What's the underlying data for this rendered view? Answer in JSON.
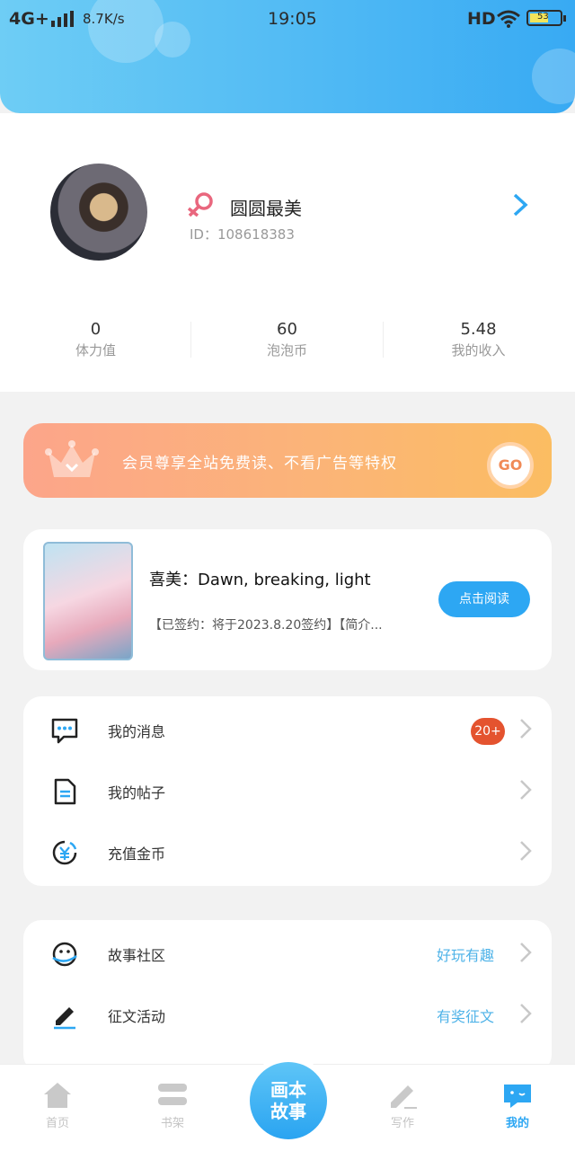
{
  "status_bar": {
    "network": "4G+",
    "speed": "8.7K/s",
    "time": "19:05",
    "hd": "HD",
    "battery": "53"
  },
  "profile": {
    "nickname": "圆圆最美",
    "user_id": "ID：108618383"
  },
  "stats": [
    {
      "value": "0",
      "label": "体力值"
    },
    {
      "value": "60",
      "label": "泡泡币"
    },
    {
      "value": "5.48",
      "label": "我的收入"
    }
  ],
  "vip_banner": {
    "text": "会员尊享全站免费读、不看广告等特权",
    "go_label": "GO"
  },
  "book": {
    "title": "喜美：Dawn, breaking, light",
    "description": "【已签约：将于2023.8.20签约】【简介...",
    "read_button": "点击阅读"
  },
  "menu_group1": [
    {
      "label": "我的消息",
      "icon": "message-icon",
      "badge": "20+"
    },
    {
      "label": "我的帖子",
      "icon": "document-icon"
    },
    {
      "label": "充值金币",
      "icon": "yuan-coin-icon"
    }
  ],
  "menu_group2": [
    {
      "label": "故事社区",
      "icon": "planet-face-icon",
      "tag": "好玩有趣"
    },
    {
      "label": "征文活动",
      "icon": "pencil-icon",
      "tag": "有奖征文"
    }
  ],
  "tabbar": {
    "home": "首页",
    "shelf": "书架",
    "center_line1": "画本",
    "center_line2": "故事",
    "write": "写作",
    "mine": "我的"
  },
  "colors": {
    "accent": "#2da7f3",
    "badge": "#e4532f",
    "tag": "#4fb3e8",
    "female": "#e9677e"
  }
}
